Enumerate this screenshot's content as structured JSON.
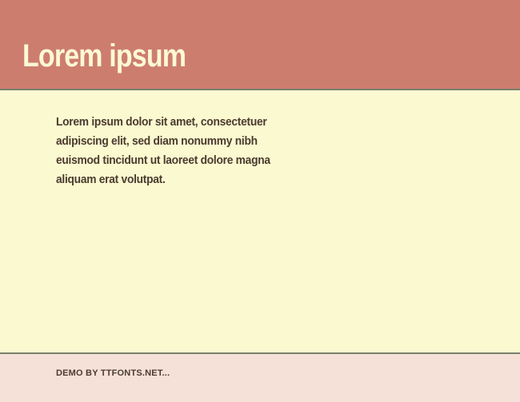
{
  "header": {
    "title": "Lorem ipsum"
  },
  "content": {
    "body": "Lorem ipsum dolor sit amet, consectetuer adipiscing elit, sed diam nonummy nibh euismod tincidunt ut laoreet dolore magna aliquam erat volutpat."
  },
  "footer": {
    "demo": "DEMO BY TTFONTS.NET..."
  }
}
